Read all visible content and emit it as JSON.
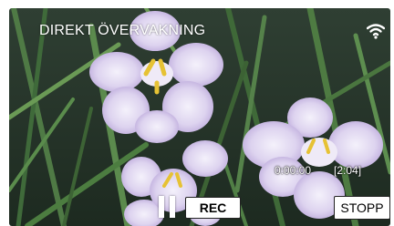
{
  "header": {
    "title": "DIREKT ÖVERVAKNING"
  },
  "status": {
    "wifi_icon": "wifi-icon"
  },
  "timer": {
    "elapsed": "0:00:00",
    "remaining": "[2:04]"
  },
  "controls": {
    "pause_icon": "pause-icon",
    "rec_label": "REC",
    "stop_label": "STOPP"
  }
}
